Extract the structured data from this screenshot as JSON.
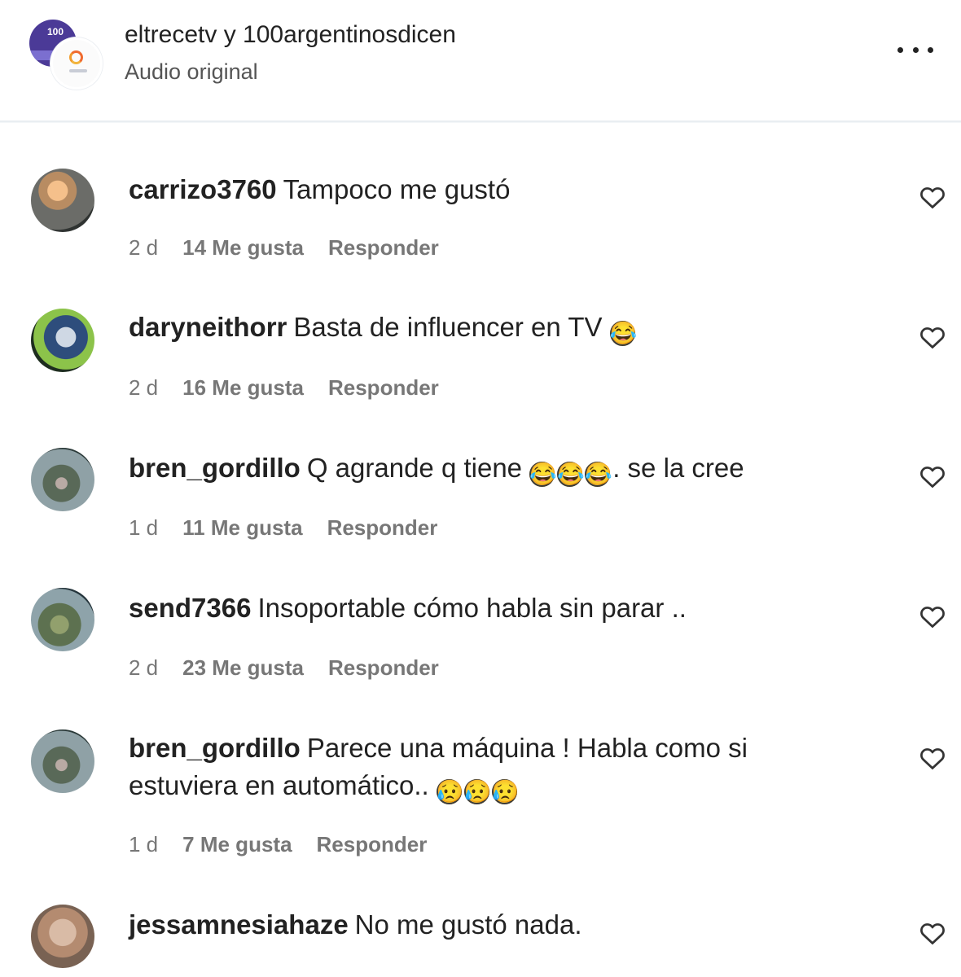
{
  "header": {
    "title": "eltrecetv y 100argentinosdicen",
    "subtitle": "Audio original",
    "avatar_text": "100"
  },
  "comments": [
    {
      "username": "carrizo3760",
      "text": "Tampoco me gustó",
      "time": "2 d",
      "likes": "14 Me gusta",
      "reply": "Responder",
      "emojis": []
    },
    {
      "username": "daryneithorr",
      "text": "Basta de influencer en TV",
      "time": "2 d",
      "likes": "16 Me gusta",
      "reply": "Responder",
      "emojis": [
        "😂"
      ]
    },
    {
      "username": "bren_gordillo",
      "text_before": "Q agrande q tiene",
      "text_after": ". se la cree",
      "time": "1 d",
      "likes": "11 Me gusta",
      "reply": "Responder",
      "emojis": [
        "😂",
        "😂",
        "😂"
      ]
    },
    {
      "username": "send7366",
      "text": "Insoportable cómo habla sin parar ..",
      "time": "2 d",
      "likes": "23 Me gusta",
      "reply": "Responder",
      "emojis": []
    },
    {
      "username": "bren_gordillo",
      "text": "Parece una máquina ! Habla como si estuviera en automático..",
      "time": "1 d",
      "likes": "7 Me gusta",
      "reply": "Responder",
      "emojis": [
        "😥",
        "😥",
        "😥"
      ]
    },
    {
      "username": "jessamnesiahaze",
      "text": "No me gustó nada.",
      "emojis": []
    }
  ],
  "icons": {
    "more": "more-options-icon",
    "heart": "heart-outline-icon"
  },
  "colors": {
    "text": "#222222",
    "secondary": "#777777",
    "divider": "#e9eef2"
  }
}
